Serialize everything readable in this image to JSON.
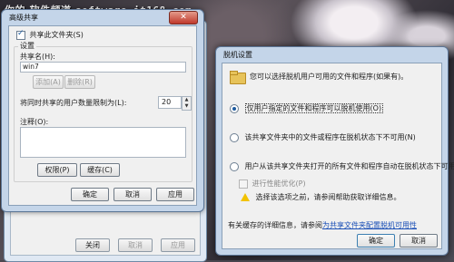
{
  "watermark": {
    "left": "你的·软件频道",
    "url": "software.it168.com"
  },
  "parent_window": {
    "buttons": {
      "close": "关闭",
      "cancel": "取消",
      "apply": "应用"
    }
  },
  "advanced_sharing": {
    "title": "高级共享",
    "close_glyph": "✕",
    "share_checkbox": "共享此文件夹(S)",
    "settings_label": "设置",
    "share_name_label": "共享名(H):",
    "share_name_value": "win7",
    "add_button": "添加(A)",
    "remove_button": "删除(R)",
    "limit_label": "将同时共享的用户数量限制为(L):",
    "limit_value": "20",
    "comment_label": "注释(O):",
    "permissions_button": "权限(P)",
    "caching_button": "缓存(C)",
    "ok_button": "确定",
    "cancel_button": "取消",
    "apply_button": "应用"
  },
  "offline_settings": {
    "title": "脱机设置",
    "intro": "您可以选择脱机用户可用的文件和程序(如果有)。",
    "options": [
      {
        "label": "仅用户指定的文件和程序可以脱机使用(O)",
        "selected": true
      },
      {
        "label": "该共享文件夹中的文件或程序在脱机状态下不可用(N)",
        "selected": false
      },
      {
        "label": "用户从该共享文件夹打开的所有文件和程序自动在脱机状态下可用(A)",
        "selected": false
      }
    ],
    "optimize_checkbox": "进行性能优化(P)",
    "warning_text": "选择该选项之前，请参阅帮助获取详细信息。",
    "cache_info_prefix": "有关缓存的详细信息，请参阅",
    "cache_info_link": "为共享文件夹配置脱机可用性",
    "ok_button": "确定",
    "cancel_button": "取消"
  }
}
